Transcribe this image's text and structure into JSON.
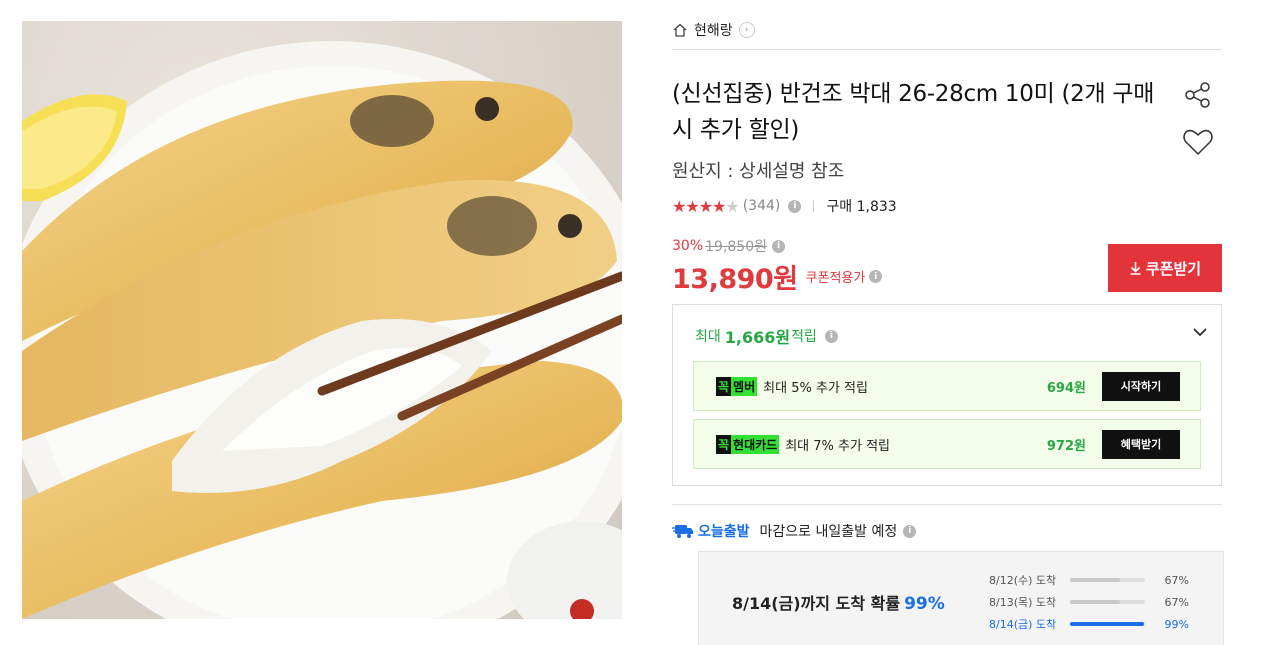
{
  "product_image": {
    "alt": "grilled dried flatfish on a white plate with chopsticks",
    "icon": "product-photo"
  },
  "brand": {
    "name": "현해랑",
    "home_icon": "home-icon",
    "chevron": "›"
  },
  "title": "(신선집중) 반건조 박대 26-28cm 10미 (2개 구매 시 추가 할인)",
  "origin": "원산지 : 상세설명 참조",
  "rating": {
    "stars": "★★★★",
    "half_star": "★",
    "review_count": "(344)",
    "sold": "구매 1,833",
    "value": 4.5
  },
  "price": {
    "discount_rate": "30%",
    "original": "19,850원",
    "sale": "13,890원",
    "coupon_note": "쿠폰적용가",
    "coupon_button": "쿠폰받기"
  },
  "points": {
    "prefix": "최대",
    "amount": "1,666원",
    "suffix": "적립",
    "benefits": [
      {
        "tag_a": "꼭",
        "tag_b": "멤버",
        "desc": "최대 5% 추가 적립",
        "amount": "694원",
        "action": "시작하기"
      },
      {
        "tag_a": "꼭",
        "tag_b": "현대카드",
        "desc": "최대 7% 추가 적립",
        "amount": "972원",
        "action": "혜택받기"
      }
    ]
  },
  "shipping": {
    "label": "오늘출발",
    "desc": "마감으로 내일출발 예정",
    "arrival_main": "8/14(금)까지 도착 확률",
    "arrival_pct": "99%",
    "arrivals": [
      {
        "date": "8/12(수) 도착",
        "pct": "67%",
        "value": 0.67
      },
      {
        "date": "8/13(목) 도착",
        "pct": "67%",
        "value": 0.67
      },
      {
        "date": "8/14(금) 도착",
        "pct": "99%",
        "value": 0.99
      }
    ]
  },
  "colors": {
    "accent_red": "#e3343b",
    "points_green": "#28a745",
    "shipping_blue": "#1a6ee6"
  }
}
